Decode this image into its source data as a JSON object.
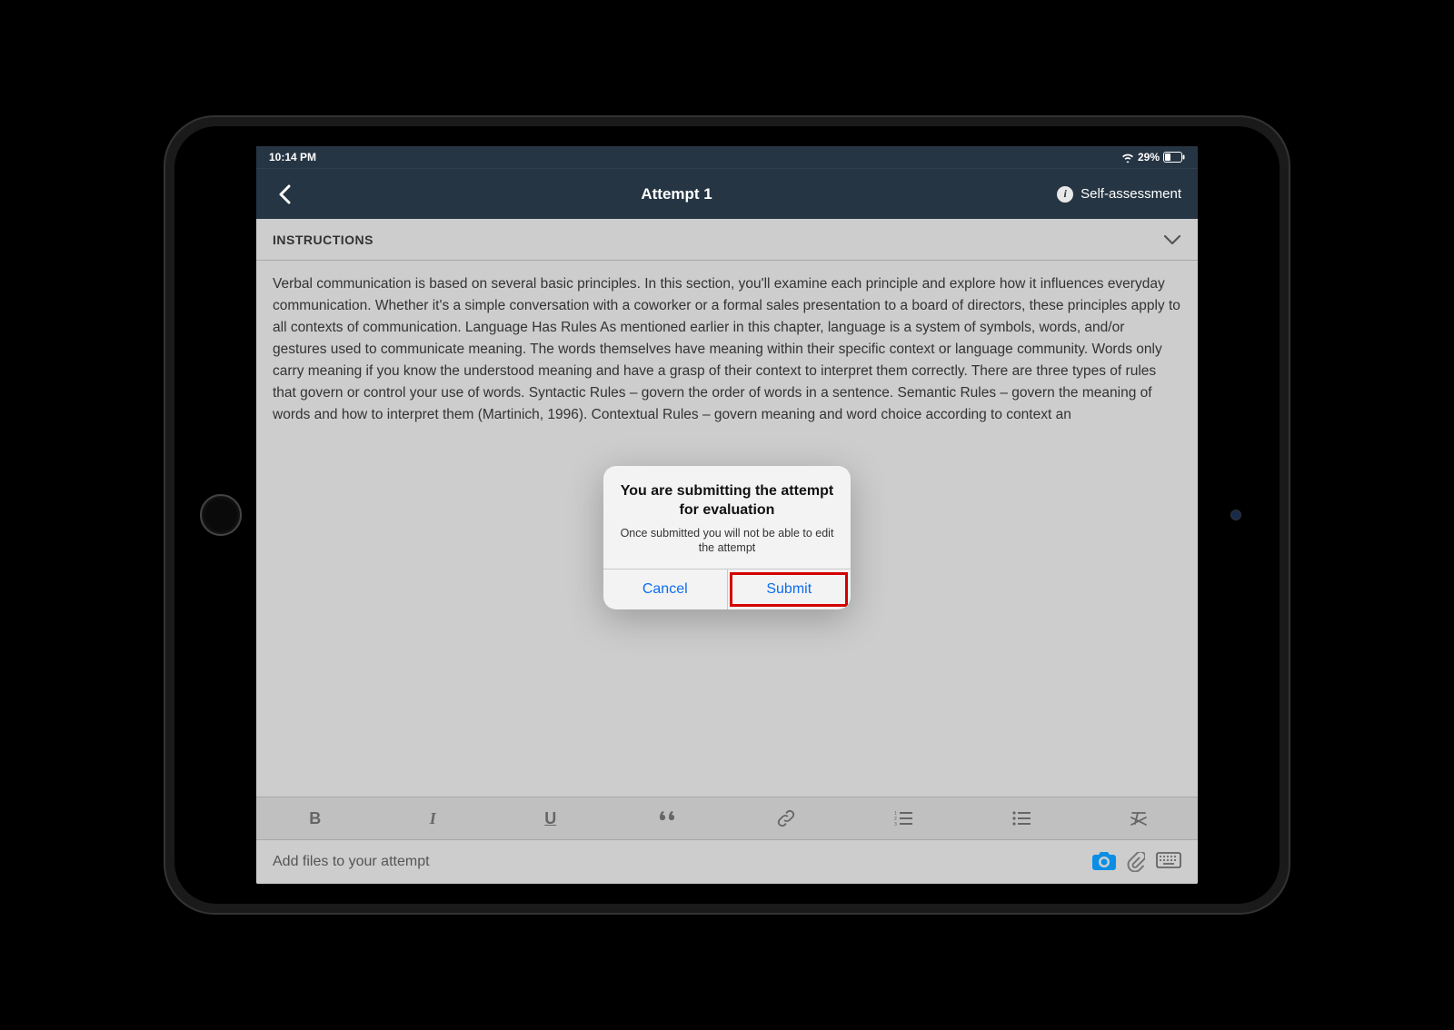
{
  "status_bar": {
    "time": "10:14 PM",
    "battery_pct": "29%"
  },
  "header": {
    "title": "Attempt 1",
    "self_assessment_label": "Self-assessment"
  },
  "instructions": {
    "heading": "INSTRUCTIONS",
    "body": "Verbal communication is based on several basic principles. In this section, you'll examine each principle and explore how it influences everyday communication. Whether it's a simple conversation with a coworker or a formal sales presentation to a board of directors, these principles apply to all contexts of communication. Language Has Rules As mentioned earlier in this chapter, language is a system of symbols, words, and/or gestures used to communicate meaning. The words themselves have meaning within their specific context or language community. Words only carry meaning if you know the understood meaning and have a grasp of their context to interpret them correctly. There are three types of rules that govern or control your use of words. Syntactic Rules – govern the order of words in a sentence. Semantic Rules – govern the meaning of words and how to interpret them (Martinich, 1996). Contextual Rules – govern meaning and word choice according to context an"
  },
  "modal": {
    "title": "You are submitting the attempt for evaluation",
    "subtitle": "Once submitted you will not be able to edit the attempt",
    "cancel": "Cancel",
    "submit": "Submit"
  },
  "bottom_bar": {
    "add_files": "Add files to your attempt"
  },
  "toolbar": {
    "bold": "B",
    "italic": "I",
    "underline": "U"
  },
  "colors": {
    "header_bg": "#263543",
    "accent_blue": "#0b6ef0",
    "camera_blue": "#0b8ee6",
    "highlight_red": "#d40000"
  }
}
